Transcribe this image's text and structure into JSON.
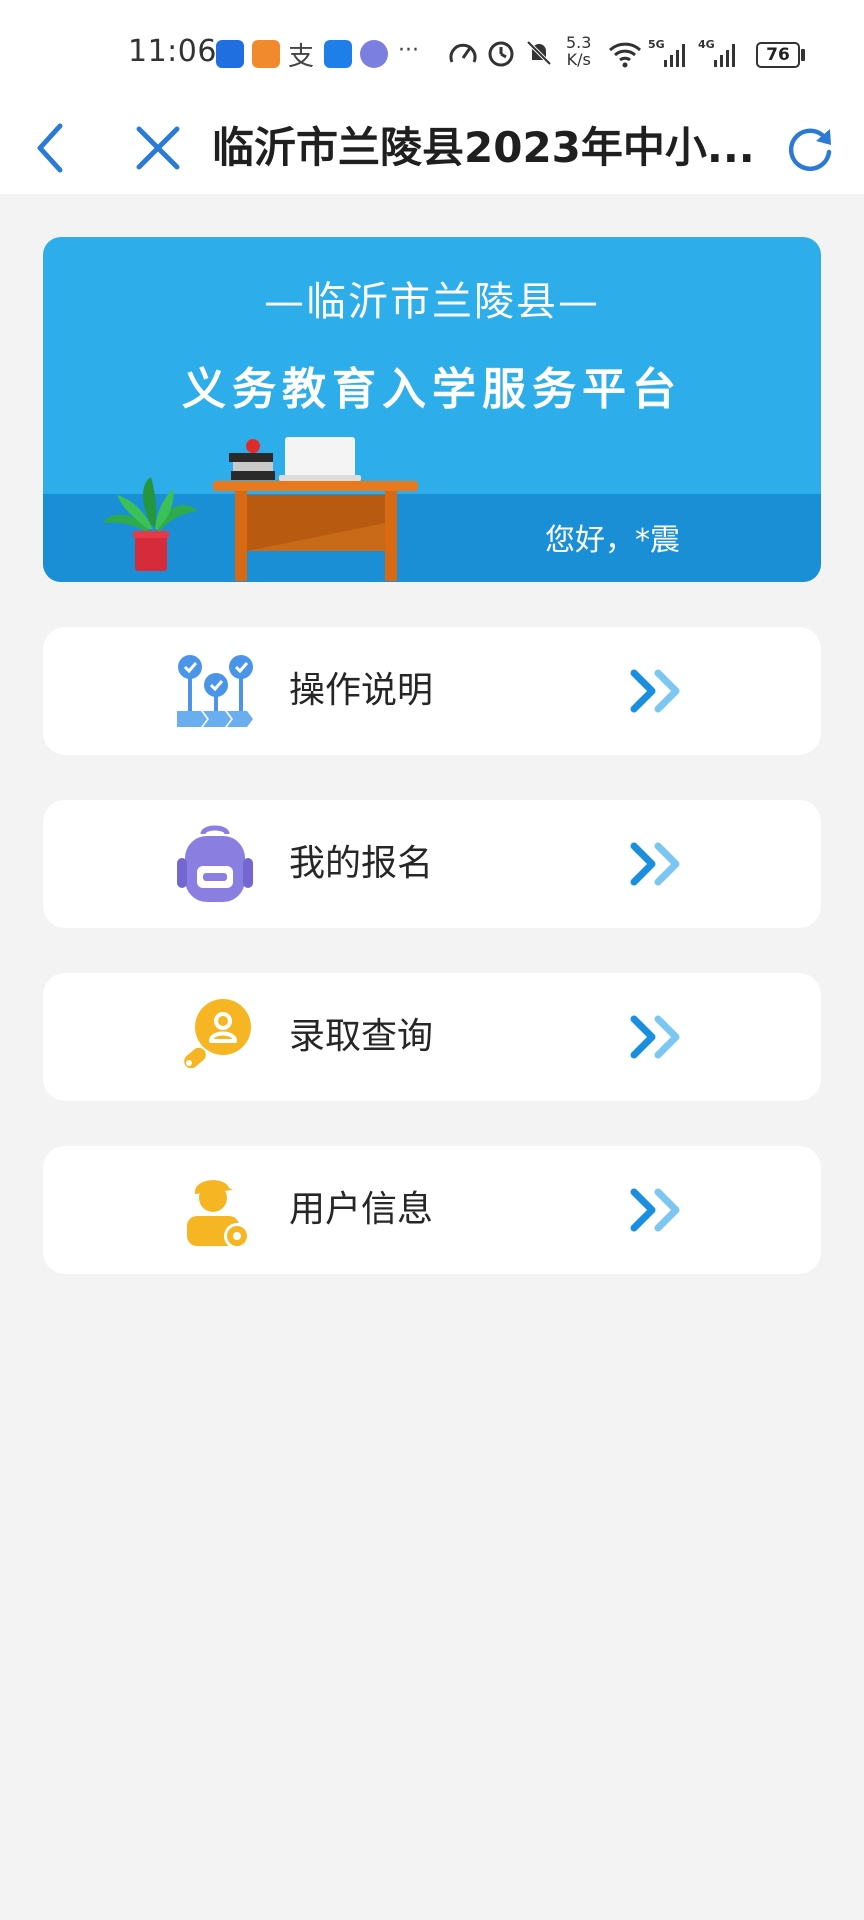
{
  "status_bar": {
    "time": "11:06",
    "more": "···",
    "speed_value": "5.3",
    "speed_unit": "K/s",
    "signal1": "5G",
    "signal2": "4G",
    "battery": "76"
  },
  "nav": {
    "title": "临沂市兰陵县2023年中小..."
  },
  "banner": {
    "subtitle": "—临沂市兰陵县—",
    "title": "义务教育入学服务平台",
    "greeting": "您好，*震"
  },
  "menu": [
    {
      "label": "操作说明",
      "icon": "steps-icon"
    },
    {
      "label": "我的报名",
      "icon": "backpack-icon"
    },
    {
      "label": "录取查询",
      "icon": "user-search-icon"
    },
    {
      "label": "用户信息",
      "icon": "user-settings-icon"
    }
  ],
  "colors": {
    "accent": "#2b7bd6",
    "banner_blue": "#2daeea",
    "banner_dark": "#1b8fd6",
    "background": "#f3f3f3"
  }
}
